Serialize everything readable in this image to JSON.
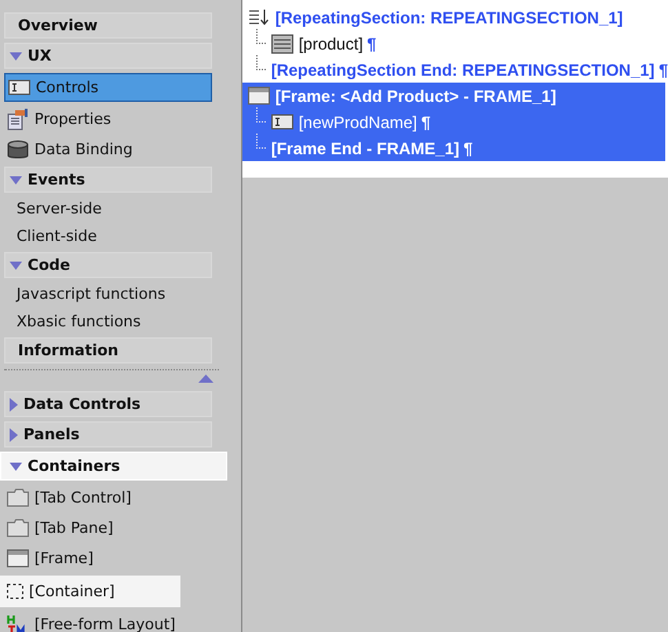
{
  "nav": [
    {
      "kind": "header",
      "label": "Overview",
      "highlighted": false
    },
    {
      "kind": "header",
      "label": "UX",
      "expanded": true,
      "highlighted": false
    },
    {
      "kind": "item",
      "label": "Controls",
      "selected": true,
      "highlighted": false
    },
    {
      "kind": "item",
      "label": "Properties",
      "selected": false,
      "highlighted": false
    },
    {
      "kind": "item",
      "label": "Data Binding",
      "selected": false,
      "highlighted": false
    },
    {
      "kind": "header",
      "label": "Events",
      "expanded": true,
      "highlighted": false
    },
    {
      "kind": "item",
      "label": "Server-side",
      "selected": false,
      "highlighted": false
    },
    {
      "kind": "item",
      "label": "Client-side",
      "selected": false,
      "highlighted": false
    },
    {
      "kind": "header",
      "label": "Code",
      "expanded": true,
      "highlighted": false
    },
    {
      "kind": "item",
      "label": "Javascript functions",
      "selected": false,
      "highlighted": false
    },
    {
      "kind": "item",
      "label": "Xbasic functions",
      "selected": false,
      "highlighted": false
    },
    {
      "kind": "header",
      "label": "Information",
      "highlighted": false
    }
  ],
  "palette": [
    {
      "kind": "header",
      "label": "Data Controls",
      "expanded": false,
      "highlighted": false
    },
    {
      "kind": "header",
      "label": "Panels",
      "expanded": false,
      "highlighted": false
    },
    {
      "kind": "header",
      "label": "Containers",
      "expanded": true,
      "highlighted": true
    },
    {
      "kind": "item",
      "label": "[Tab Control]",
      "selected": false,
      "highlighted": false
    },
    {
      "kind": "item",
      "label": "[Tab Pane]",
      "selected": false,
      "highlighted": false
    },
    {
      "kind": "item",
      "label": "[Frame]",
      "selected": false,
      "highlighted": false
    },
    {
      "kind": "item",
      "label": "[Container]",
      "selected": false,
      "highlighted": true
    },
    {
      "kind": "item",
      "label": "[Free-form Layout]",
      "selected": false,
      "highlighted": false
    }
  ],
  "tree": [
    {
      "kind": "repeating",
      "text": "[RepeatingSection: REPEATINGSECTION_1]",
      "selected": false,
      "children": [
        {
          "kind": "list",
          "text": "[product]",
          "mark": "¶",
          "selected": false
        },
        {
          "kind": "end",
          "text": "[RepeatingSection End: REPEATINGSECTION_1]",
          "mark": "¶",
          "selected": false
        }
      ]
    },
    {
      "kind": "frame",
      "text": "[Frame: <Add Product> - FRAME_1]",
      "selected": true,
      "children": [
        {
          "kind": "field",
          "text": "[newProdName]",
          "mark": "¶",
          "selected": true
        },
        {
          "kind": "end",
          "text": "[Frame End - FRAME_1]",
          "mark": "¶",
          "selected": true
        }
      ]
    }
  ]
}
